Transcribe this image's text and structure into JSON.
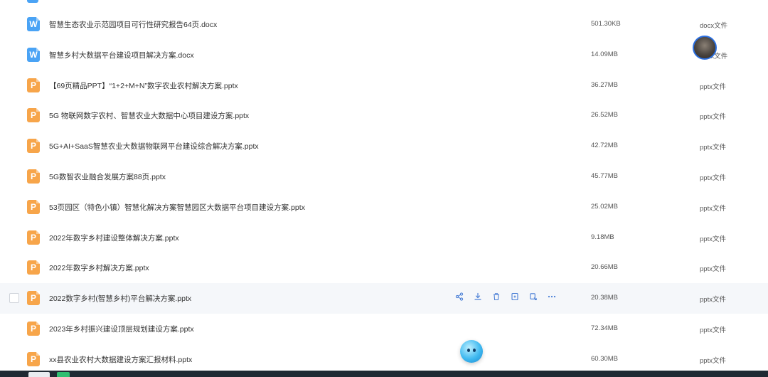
{
  "files": [
    {
      "name": "智慧生态农业示范园项目可行性研究报告64页.docx",
      "size": "501.30KB",
      "type": "docx文件",
      "kind": "docx",
      "icon_letter": "W"
    },
    {
      "name": "智慧乡村大数据平台建设项目解决方案.docx",
      "size": "14.09MB",
      "type": "docx文件",
      "kind": "docx",
      "icon_letter": "W"
    },
    {
      "name": "【69页精品PPT】“1+2+M+N”数字农业农村解决方案.pptx",
      "size": "36.27MB",
      "type": "pptx文件",
      "kind": "pptx",
      "icon_letter": "P"
    },
    {
      "name": "5G 物联网数字农村、智慧农业大数据中心项目建设方案.pptx",
      "size": "26.52MB",
      "type": "pptx文件",
      "kind": "pptx",
      "icon_letter": "P"
    },
    {
      "name": "5G+AI+SaaS智慧农业大数据物联网平台建设综合解决方案.pptx",
      "size": "42.72MB",
      "type": "pptx文件",
      "kind": "pptx",
      "icon_letter": "P"
    },
    {
      "name": "5G数智农业融合发展方案88页.pptx",
      "size": "45.77MB",
      "type": "pptx文件",
      "kind": "pptx",
      "icon_letter": "P"
    },
    {
      "name": "53页园区（特色小镇）智慧化解决方案智慧园区大数据平台项目建设方案.pptx",
      "size": "25.02MB",
      "type": "pptx文件",
      "kind": "pptx",
      "icon_letter": "P"
    },
    {
      "name": "2022年数字乡村建设整体解决方案.pptx",
      "size": "9.18MB",
      "type": "pptx文件",
      "kind": "pptx",
      "icon_letter": "P"
    },
    {
      "name": "2022年数字乡村解决方案.pptx",
      "size": "20.66MB",
      "type": "pptx文件",
      "kind": "pptx",
      "icon_letter": "P"
    },
    {
      "name": "2022数字乡村(智慧乡村)平台解决方案.pptx",
      "size": "20.38MB",
      "type": "pptx文件",
      "kind": "pptx",
      "icon_letter": "P",
      "hovered": true
    },
    {
      "name": "2023年乡村振兴建设顶层规划建设方案.pptx",
      "size": "72.34MB",
      "type": "pptx文件",
      "kind": "pptx",
      "icon_letter": "P"
    },
    {
      "name": "xx县农业农村大数据建设方案汇报材料.pptx",
      "size": "60.30MB",
      "type": "pptx文件",
      "kind": "pptx",
      "icon_letter": "P"
    }
  ],
  "row_actions": [
    "share-icon",
    "download-icon",
    "delete-icon",
    "move-icon",
    "copy-icon",
    "more-icon"
  ],
  "colors": {
    "docx": "#4aa3f5",
    "pptx": "#f7a54a",
    "action": "#4a7fd6",
    "hover_row": "#f5f7fa"
  }
}
